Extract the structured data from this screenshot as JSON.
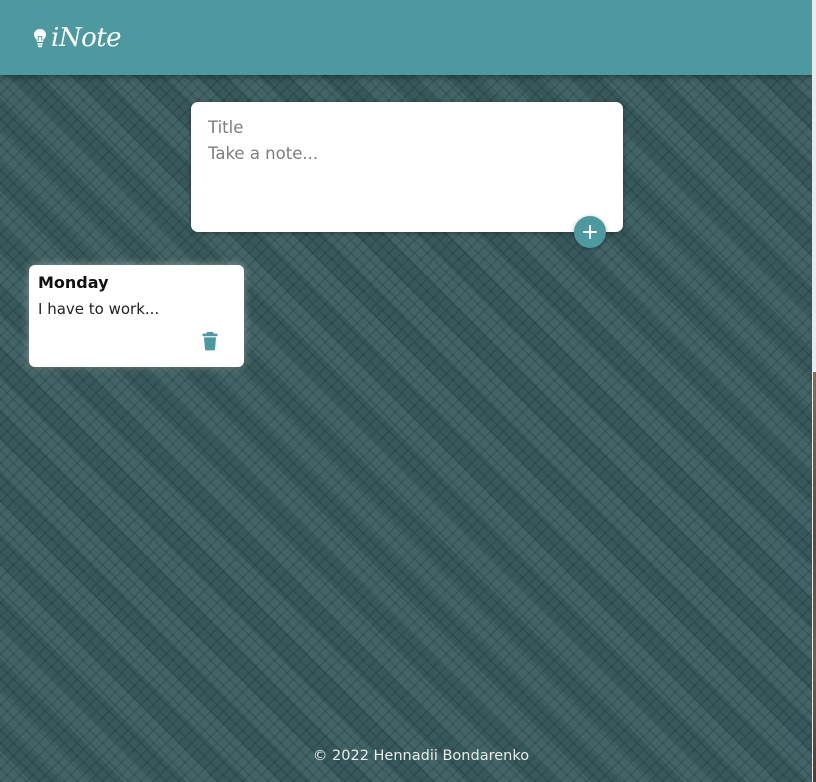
{
  "app": {
    "name": "iNote",
    "logo_icon": "lightbulb-icon",
    "accent_color": "#4c9a9f"
  },
  "composer": {
    "title_placeholder": "Title",
    "body_placeholder": "Take a note...",
    "add_icon": "plus-icon"
  },
  "notes": [
    {
      "title": "Monday",
      "content": "I have to work...",
      "delete_icon": "trash-icon"
    }
  ],
  "footer": {
    "text": "© 2022 Hennadii Bondarenko"
  }
}
